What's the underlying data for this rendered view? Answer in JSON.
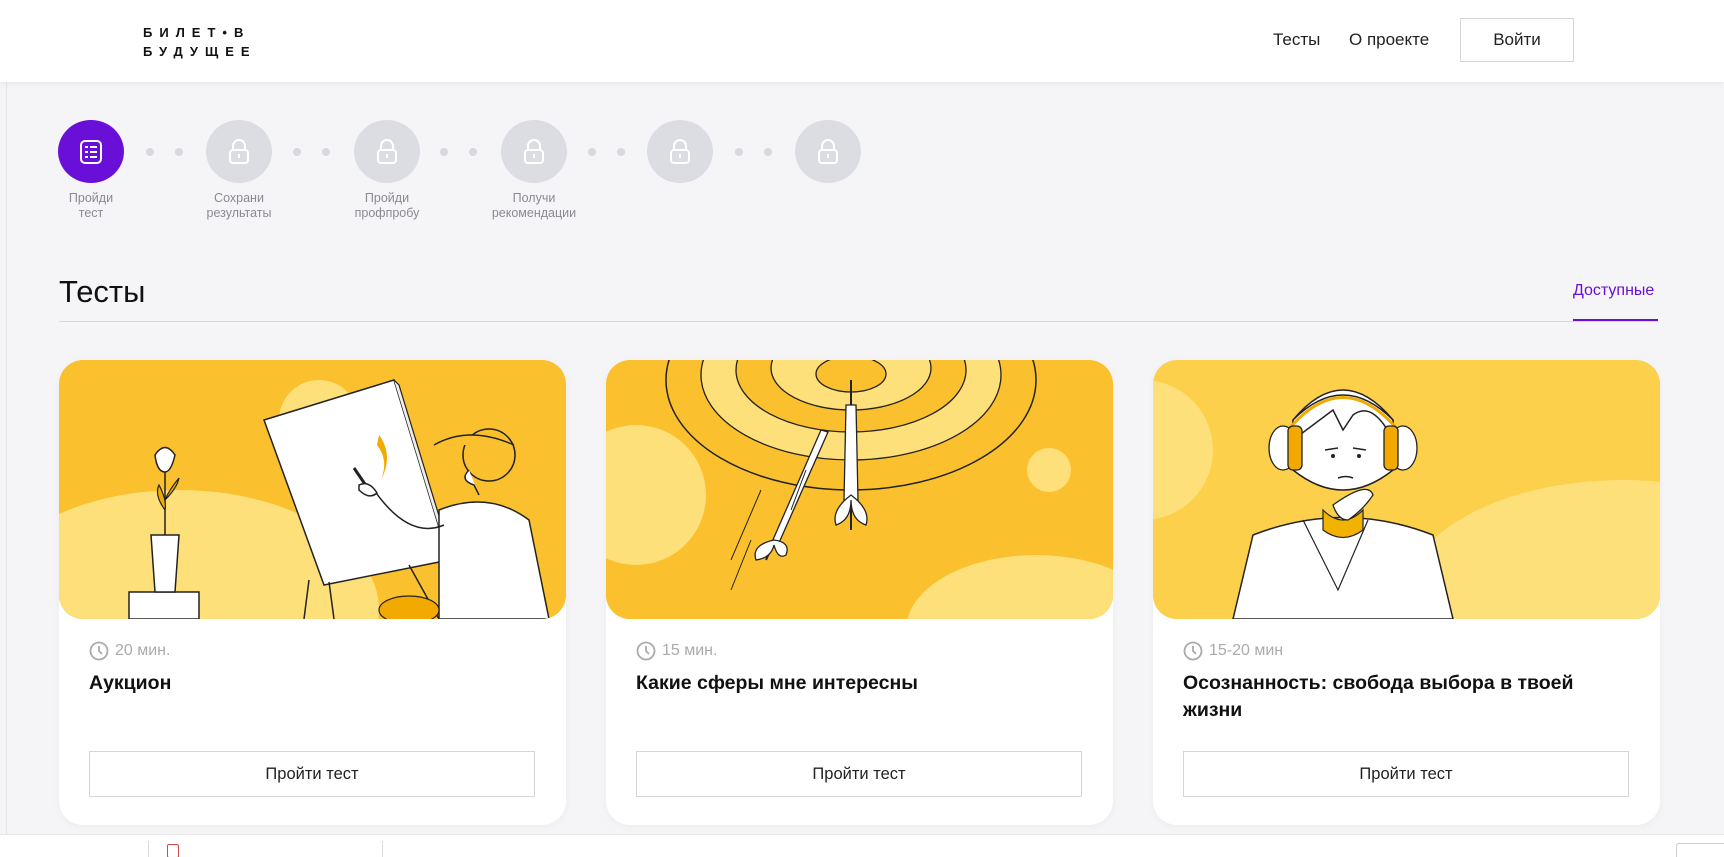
{
  "header": {
    "logo_line1": "БИЛЕТ•В",
    "logo_line2": "БУДУЩЕЕ",
    "nav_tests": "Тесты",
    "nav_about": "О проекте",
    "login": "Войти"
  },
  "steps": [
    {
      "label_line1": "Пройди",
      "label_line2": "тест",
      "state": "active",
      "icon": "test-list-icon"
    },
    {
      "label_line1": "Сохрани",
      "label_line2": "результаты",
      "state": "locked",
      "icon": "lock-icon"
    },
    {
      "label_line1": "Пройди",
      "label_line2": "профпробу",
      "state": "locked",
      "icon": "lock-icon"
    },
    {
      "label_line1": "Получи",
      "label_line2": "рекомендации",
      "state": "locked",
      "icon": "lock-icon"
    },
    {
      "label_line1": "",
      "label_line2": "",
      "state": "locked",
      "icon": "lock-icon"
    },
    {
      "label_line1": "",
      "label_line2": "",
      "state": "locked",
      "icon": "lock-icon"
    }
  ],
  "section": {
    "title": "Тесты",
    "tab_available": "Доступные"
  },
  "cards": [
    {
      "duration": "20 мин.",
      "title": "Аукцион",
      "button": "Пройти тест",
      "illustration": "painter-at-easel"
    },
    {
      "duration": "15 мин.",
      "title": "Какие сферы мне интересны",
      "button": "Пройти тест",
      "illustration": "darts-target"
    },
    {
      "duration": "15-20 мин",
      "title": "Осознанность: свобода выбора в твоей жизни",
      "button": "Пройти тест",
      "illustration": "thinking-person-headphones"
    }
  ],
  "colors": {
    "accent": "#6a0fd8",
    "card_yellow": "#fbc02d",
    "card_yellow_light": "#fde07a",
    "locked_gray": "#dcdce3"
  }
}
